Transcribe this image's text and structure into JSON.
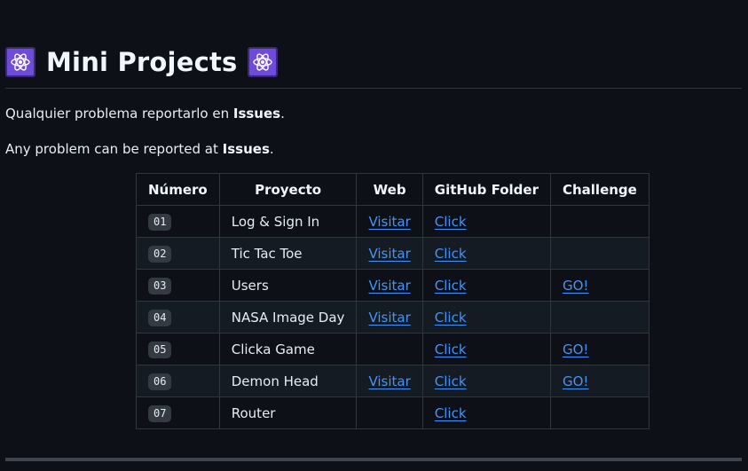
{
  "header": {
    "title": "Mini Projects",
    "left_emoji": "atom-icon",
    "right_emoji": "atom-icon",
    "emoji_color": "#6e4bd8"
  },
  "intro": {
    "es_prefix": "Qualquier problema reportarlo en ",
    "es_link": "Issues",
    "es_suffix": ".",
    "en_prefix": "Any problem can be reported at ",
    "en_link": "Issues",
    "en_suffix": "."
  },
  "table": {
    "columns": [
      "Número",
      "Proyecto",
      "Web",
      "GitHub Folder",
      "Challenge"
    ],
    "rows": [
      {
        "num": "01",
        "name": "Log & Sign In",
        "web": "Visitar",
        "folder": "Click",
        "challenge": ""
      },
      {
        "num": "02",
        "name": "Tic Tac Toe",
        "web": "Visitar",
        "folder": "Click",
        "challenge": ""
      },
      {
        "num": "03",
        "name": "Users",
        "web": "Visitar",
        "folder": "Click",
        "challenge": "GO!"
      },
      {
        "num": "04",
        "name": "NASA Image Day",
        "web": "Visitar",
        "folder": "Click",
        "challenge": ""
      },
      {
        "num": "05",
        "name": "Clicka Game",
        "web": "",
        "folder": "Click",
        "challenge": "GO!"
      },
      {
        "num": "06",
        "name": "Demon Head",
        "web": "Visitar",
        "folder": "Click",
        "challenge": "GO!"
      },
      {
        "num": "07",
        "name": "Router",
        "web": "",
        "folder": "Click",
        "challenge": ""
      }
    ]
  },
  "colors": {
    "background": "#0d1117",
    "link": "#4493f8",
    "border": "#30363d"
  }
}
